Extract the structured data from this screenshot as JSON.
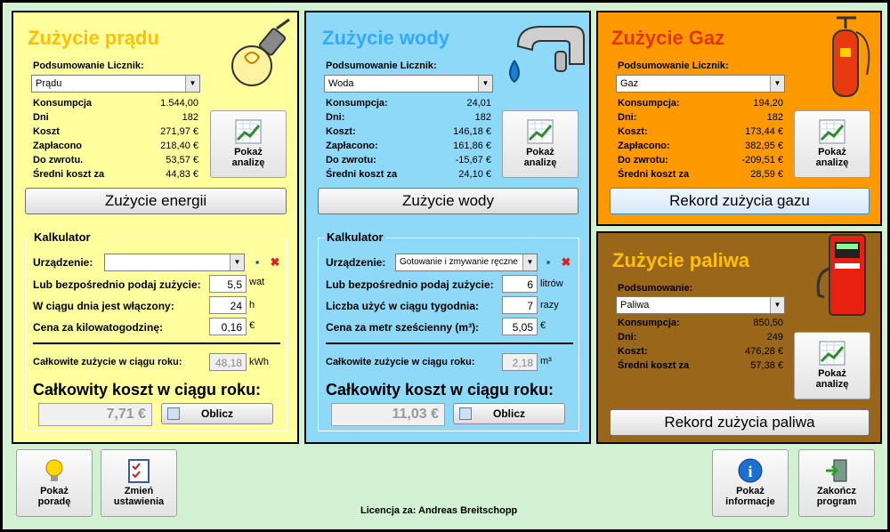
{
  "colors": {
    "electric_bg": "#ffff9e",
    "water_bg": "#8ed8f8",
    "gas_bg": "#ff9900",
    "fuel_bg": "#99661a",
    "electric_title": "#ffc000",
    "water_title": "#33aaff",
    "gas_title": "#e0360e",
    "fuel_title": "#ffc000",
    "app_bg": "#d2f0d2"
  },
  "electric": {
    "title": "Zużycie prądu",
    "summary_label": "Podsumowanie Licznik:",
    "summary_value": "Prądu",
    "stats": [
      {
        "label": "Konsumpcja",
        "value": "1.544,00"
      },
      {
        "label": "Dni",
        "value": "182"
      },
      {
        "label": "Koszt",
        "value": "271,97 €"
      },
      {
        "label": "Zapłacono",
        "value": "218,40 €"
      },
      {
        "label": "Do zwrotu.",
        "value": "53,57 €"
      },
      {
        "label": "Średni koszt za",
        "value": "44,83 €"
      }
    ],
    "analysis_button": "Pokaż\nanalizę",
    "usage_button": "Zużycie energii",
    "calc": {
      "legend": "Kalkulator",
      "device_label": "Urządzenie:",
      "device_value": "",
      "direct_label": "Lub bezpośrednio podaj zużycie:",
      "direct_value": "5,5",
      "direct_unit": "wat",
      "hours_label": "W ciągu dnia jest włączony:",
      "hours_value": "24",
      "hours_unit": "h",
      "price_label": "Cena za kilowatogodzinę:",
      "price_value": "0,16",
      "price_unit": "€",
      "annual_label": "Całkowite zużycie w ciągu roku:",
      "annual_value": "48,18",
      "annual_unit": "kWh",
      "total_label": "Całkowity koszt w ciągu roku:",
      "total_value": "7,71 €",
      "calc_button": "Oblicz"
    }
  },
  "water": {
    "title": "Zużycie wody",
    "summary_label": "Podsumowanie Licznik:",
    "summary_value": "Woda",
    "stats": [
      {
        "label": "Konsumpcja:",
        "value": "24,01"
      },
      {
        "label": "Dni:",
        "value": "182"
      },
      {
        "label": "Koszt:",
        "value": "146,18 €"
      },
      {
        "label": "Zapłacono:",
        "value": "161,86 €"
      },
      {
        "label": "Do zwrotu:",
        "value": "-15,67 €"
      },
      {
        "label": "Średni koszt za",
        "value": "24,10 €"
      }
    ],
    "analysis_button": "Pokaż\nanalizę",
    "usage_button": "Zużycie wody",
    "calc": {
      "legend": "Kalkulator",
      "device_label": "Urządzenie:",
      "device_value": "Gotowanie i zmywanie ręczne",
      "direct_label": "Lub bezpośrednio podaj zużycie:",
      "direct_value": "6",
      "direct_unit": "litrów",
      "uses_label": "Liczba użyć w ciągu tygodnia:",
      "uses_value": "7",
      "uses_unit": "razy",
      "price_label": "Cena za metr sześcienny (m³):",
      "price_value": "5,05",
      "price_unit": "€",
      "annual_label": "Całkowite zużycie w ciągu roku:",
      "annual_value": "2,18",
      "annual_unit": "m³",
      "total_label": "Całkowity koszt w ciągu roku:",
      "total_value": "11,03 €",
      "calc_button": "Oblicz"
    }
  },
  "gas": {
    "title": "Zużycie Gaz",
    "summary_label": "Podsumowanie Licznik:",
    "summary_value": "Gaz",
    "stats": [
      {
        "label": "Konsumpcja:",
        "value": "194,20"
      },
      {
        "label": "Dni:",
        "value": "182"
      },
      {
        "label": "Koszt:",
        "value": "173,44 €"
      },
      {
        "label": "Zapłacono:",
        "value": "382,95 €"
      },
      {
        "label": "Do zwrotu:",
        "value": "-209,51 €"
      },
      {
        "label": "Średni koszt za",
        "value": "28,59 €"
      }
    ],
    "analysis_button": "Pokaż\nanalizę",
    "record_button": "Rekord zużycia gazu"
  },
  "fuel": {
    "title": "Zużycie paliwa",
    "summary_label": "Podsumowanie:",
    "summary_value": "Paliwa",
    "stats": [
      {
        "label": "Konsumpcja:",
        "value": "850,50"
      },
      {
        "label": "Dni:",
        "value": "249"
      },
      {
        "label": "Koszt:",
        "value": "476,28 €"
      },
      {
        "label": "Średni koszt za",
        "value": "57,38 €"
      }
    ],
    "analysis_button": "Pokaż\nanalizę",
    "record_button": "Rekord zużycia paliwa"
  },
  "footer": {
    "tip_button": "Pokaż\nporadę",
    "settings_button": "Zmień\nustawienia",
    "license": "Licencja za: Andreas Breitschopp",
    "info_button": "Pokaż\ninformacje",
    "exit_button": "Zakończ\nprogram"
  }
}
